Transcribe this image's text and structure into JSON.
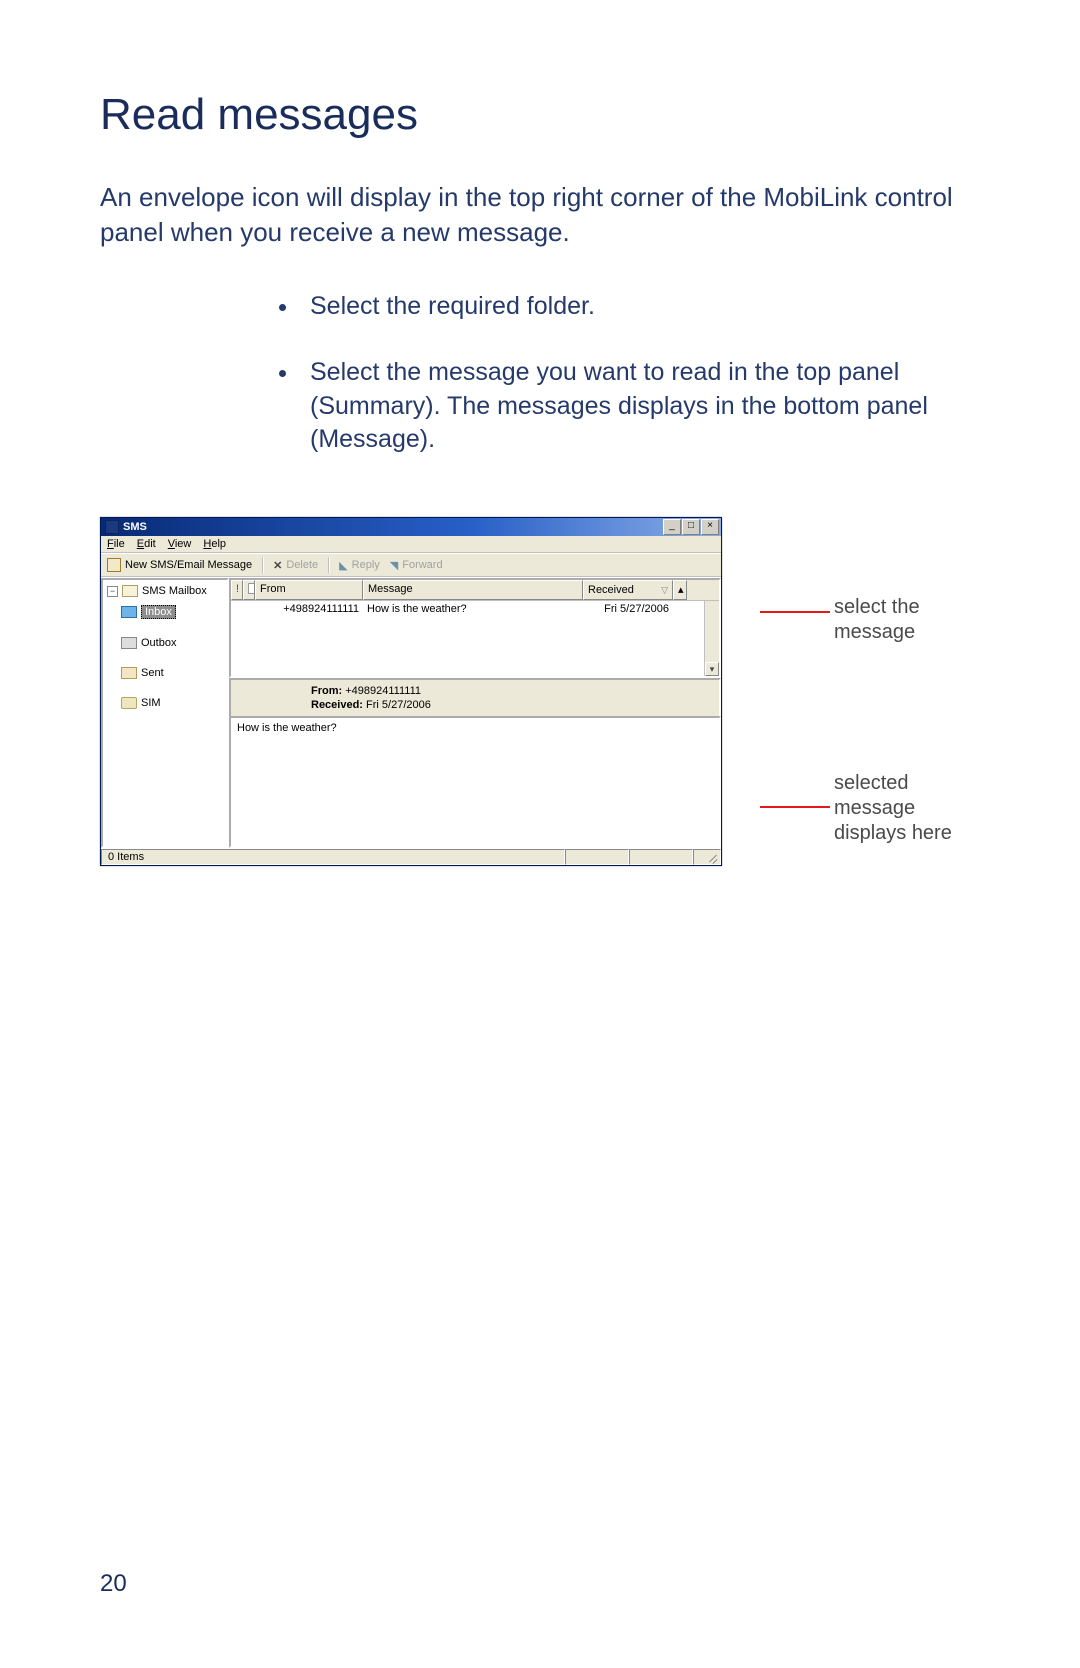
{
  "heading": "Read messages",
  "intro": "An envelope icon will display in the top right corner of the MobiLink control panel when you receive a new message.",
  "bullets": [
    "Select the required folder.",
    "Select the message you want to read in the top panel (Summary). The messages displays in the bottom panel (Message)."
  ],
  "app": {
    "title": "SMS",
    "menu": {
      "file": "File",
      "edit": "Edit",
      "view": "View",
      "help": "Help"
    },
    "toolbar": {
      "new_msg": "New SMS/Email Message",
      "delete": "Delete",
      "reply": "Reply",
      "forward": "Forward"
    },
    "tree": {
      "root": "SMS Mailbox",
      "inbox": "Inbox",
      "outbox": "Outbox",
      "sent": "Sent",
      "sim": "SIM"
    },
    "list_headers": {
      "from": "From",
      "message": "Message",
      "received": "Received"
    },
    "row": {
      "from": "+498924111111",
      "message": "How is the weather?",
      "received": "Fri 5/27/2006"
    },
    "detail": {
      "from_label": "From:",
      "from_value": "+498924111111",
      "received_label": "Received:",
      "received_value": "Fri 5/27/2006",
      "body": "How is the weather?"
    },
    "statusbar": "0 Items"
  },
  "callouts": {
    "select_msg": "select the message",
    "selected_display": "selected message displays here"
  },
  "page_number": "20"
}
